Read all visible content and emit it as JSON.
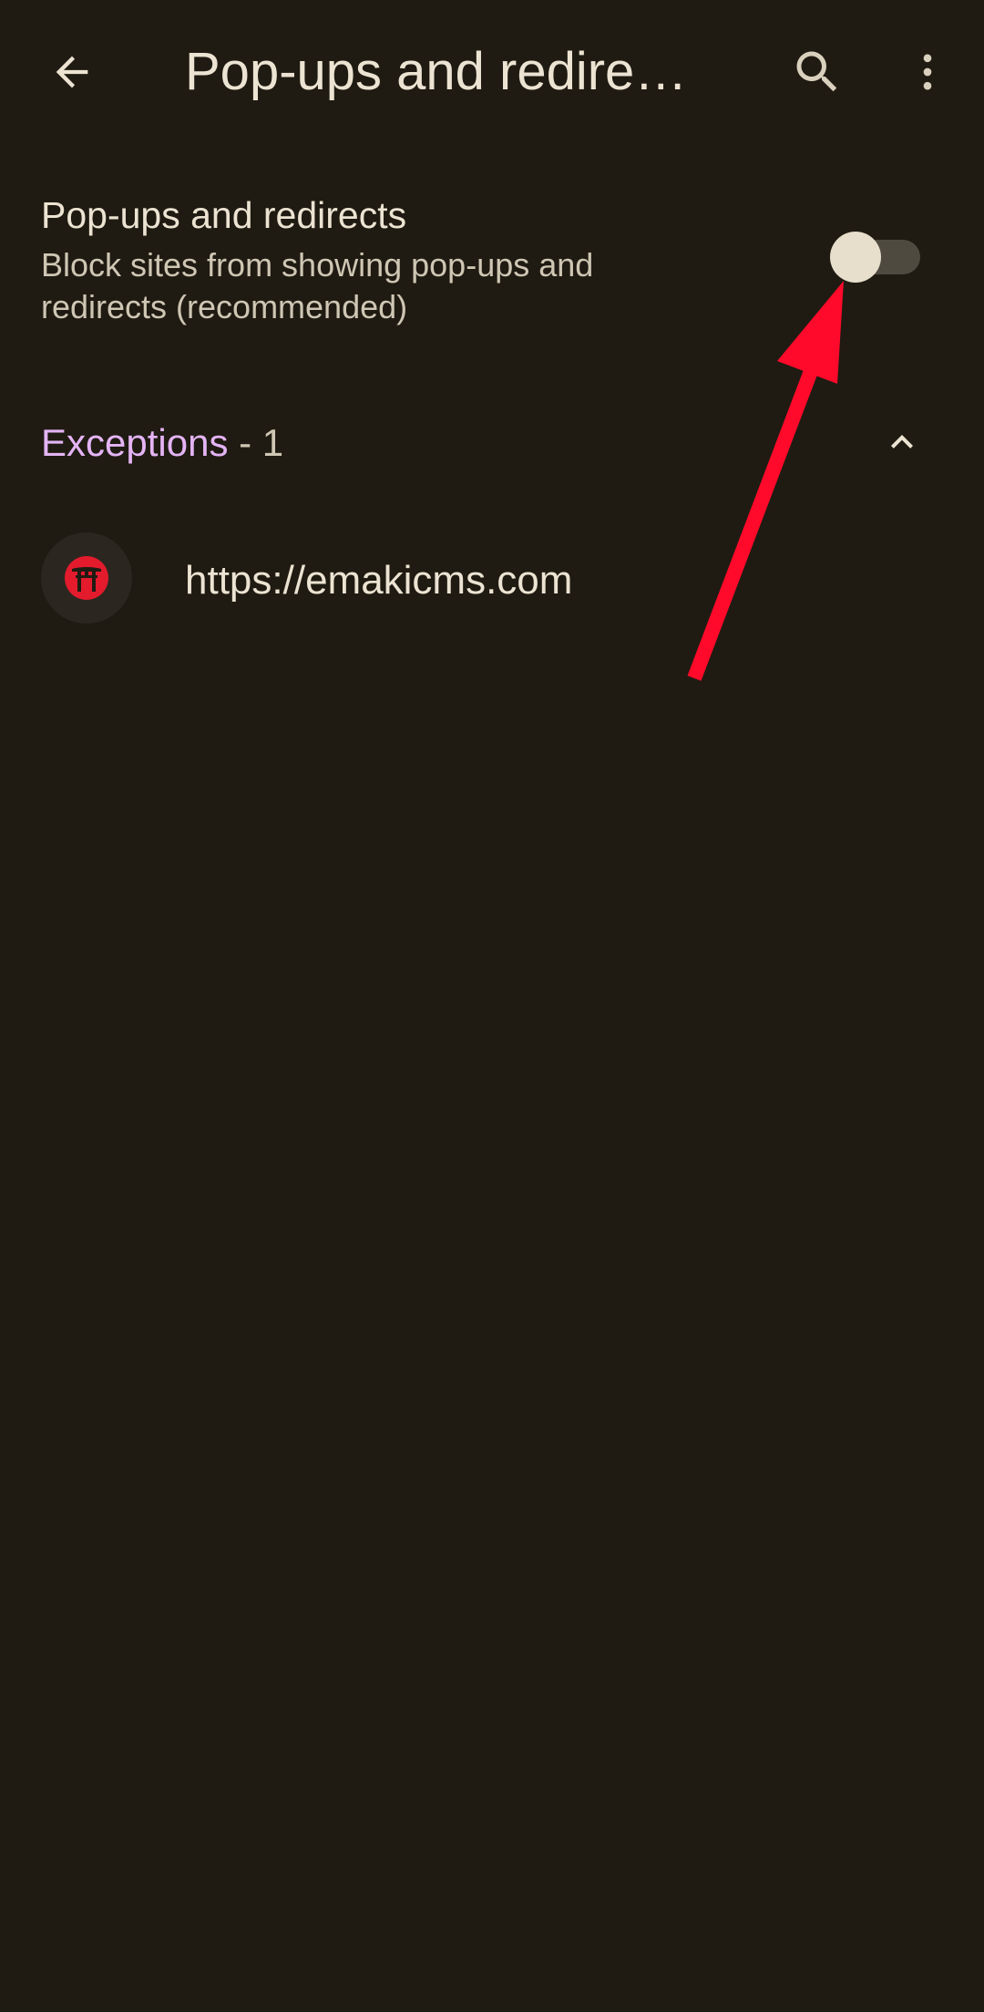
{
  "app_bar": {
    "title": "Pop-ups and redire…",
    "back_icon": "arrow-back-icon",
    "search_icon": "search-icon",
    "more_icon": "more-vert-icon"
  },
  "setting": {
    "title": "Pop-ups and redirects",
    "summary": "Block sites from showing pop-ups and redirects (recommended)",
    "toggle_on": false
  },
  "exceptions": {
    "label": "Exceptions",
    "count_text": " - 1",
    "expanded_icon": "chevron-up-icon"
  },
  "sites": [
    {
      "url": "https://emakicms.com",
      "favicon": "torii-gate-icon"
    }
  ],
  "colors": {
    "background": "#1f1b12",
    "accent": "#e4b4f4",
    "text": "#ece3d2",
    "annotation": "#ff0a2a"
  }
}
